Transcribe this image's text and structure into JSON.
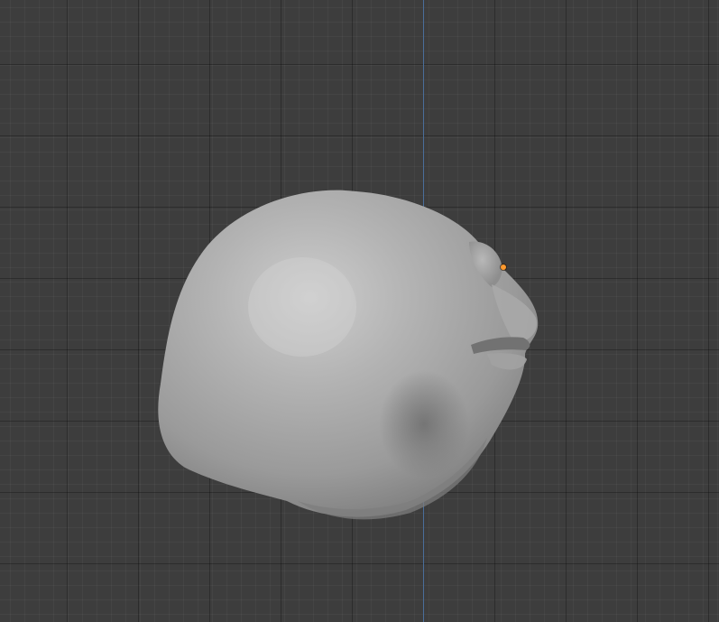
{
  "viewport": {
    "background_color": "#3d3d3d",
    "axis_color": "#4a6e9a",
    "object": {
      "type": "sculpted-mesh",
      "description_icon": "blob-head-mesh-icon",
      "origin_color": "#ff9a2e"
    }
  }
}
